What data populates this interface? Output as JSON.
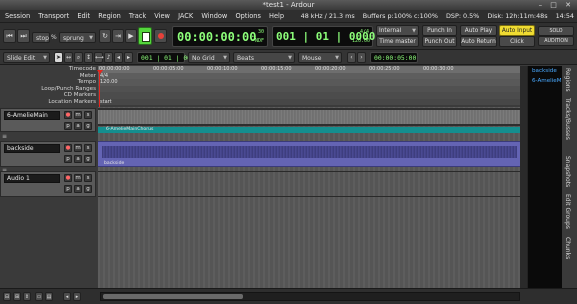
{
  "window": {
    "title": "*test1 - Ardour",
    "controls": "– □ ✕"
  },
  "menu": {
    "items": [
      "Session",
      "Transport",
      "Edit",
      "Region",
      "Track",
      "View",
      "JACK",
      "Window",
      "Options",
      "Help"
    ]
  },
  "status": {
    "rate": "48 kHz / 21.3 ms",
    "buffers": "Buffers p:100% c:100%",
    "dsp": "DSP:  0.5%",
    "disk": "Disk: 12h:11m:48s",
    "time": "14:54"
  },
  "transport": {
    "stop_mode": "stop",
    "percent": "%",
    "shuttle": "sprung",
    "clock_primary": "00:00:00:00",
    "clock_primary_fps": "30",
    "clock_primary_df": "NDF",
    "clock_secondary": "001 | 01 | 0000",
    "clock_secondary_meter": "4/4",
    "clock_secondary_tempo": "120.00",
    "sync_label": "Internal",
    "time_master": "Time master",
    "punch_in": "Punch In",
    "punch_out": "Punch Out",
    "auto_play": "Auto Play",
    "auto_return": "Auto Return",
    "auto_input": "Auto Input",
    "click": "Click",
    "solo": "SOLO",
    "audition": "AUDITION"
  },
  "edit_toolbar": {
    "edit_mode": "Slide Edit",
    "nudge_clock": "001 | 01 | 0000",
    "grid": "No Grid",
    "snap_unit": "Beats",
    "edit_point": "Mouse",
    "zoom_clock": "00:00:05:00"
  },
  "rulers": {
    "labels": [
      "Timecode",
      "Meter",
      "Tempo",
      "Loop/Punch Ranges",
      "CD Markers",
      "Location Markers"
    ],
    "timecode_ticks": [
      "00:00:00:00",
      "00:00:05:00",
      "00:00:10:00",
      "00:00:15:00",
      "00:00:20:00",
      "00:00:25:00",
      "00:00:30:00"
    ],
    "meter_value": "4/4",
    "tempo_value": "120.00",
    "location_value": "start"
  },
  "tracks": [
    {
      "name": "6-AmelieMain",
      "region": "6-AmelieMainChorus",
      "rec": "●",
      "mute": "m",
      "solo": "s",
      "playlist": "p",
      "automation": "a",
      "group": "g"
    },
    {
      "name": "backside",
      "region": "backside",
      "rec": "●",
      "mute": "m",
      "solo": "s",
      "playlist": "p",
      "automation": "a",
      "group": "g"
    },
    {
      "name": "Audio 1",
      "region": "",
      "rec": "●",
      "mute": "m",
      "solo": "s",
      "playlist": "p",
      "automation": "a",
      "group": "g"
    }
  ],
  "regions_list": [
    "backside",
    "6-AmelieM"
  ],
  "side_tabs": [
    "Regions",
    "Tracks/Busses",
    "Snapshots",
    "Edit Groups",
    "Chunks"
  ],
  "colors": {
    "clock_green": "#8dff7a",
    "auto_input": "#f0dc32",
    "region_teal": "#148e8e",
    "region_purple": "#6464b4",
    "region_list_blue": "#49a9ff"
  }
}
